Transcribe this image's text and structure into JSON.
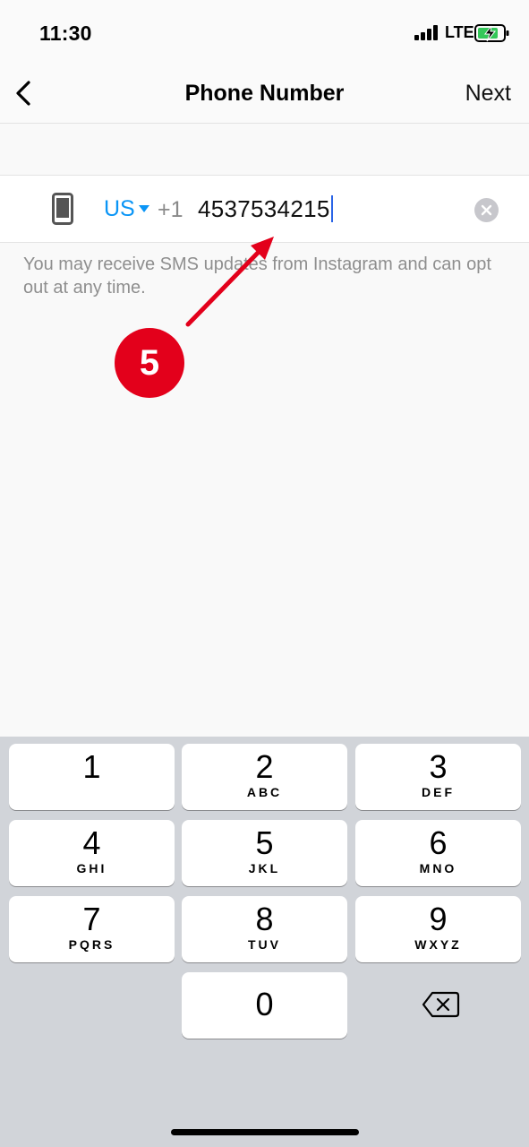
{
  "status_bar": {
    "time": "11:30",
    "network": "LTE",
    "icons": [
      "signal-bars-icon",
      "battery-charging-icon"
    ]
  },
  "nav": {
    "back_icon": "chevron-left-icon",
    "title": "Phone Number",
    "next_label": "Next"
  },
  "phone_input": {
    "device_icon": "smartphone-icon",
    "country": "US",
    "country_dropdown_icon": "caret-down-icon",
    "dial_code": "+1",
    "value": "4537534215",
    "clear_icon": "clear-x-icon"
  },
  "helper_text": "You may receive SMS updates from Instagram and can opt out at any time.",
  "annotation": {
    "step_number": "5",
    "color": "#e3001b"
  },
  "keypad": {
    "keys": [
      {
        "number": "1",
        "letters": ""
      },
      {
        "number": "2",
        "letters": "ABC"
      },
      {
        "number": "3",
        "letters": "DEF"
      },
      {
        "number": "4",
        "letters": "GHI"
      },
      {
        "number": "5",
        "letters": "JKL"
      },
      {
        "number": "6",
        "letters": "MNO"
      },
      {
        "number": "7",
        "letters": "PQRS"
      },
      {
        "number": "8",
        "letters": "TUV"
      },
      {
        "number": "9",
        "letters": "WXYZ"
      },
      {
        "number": "0",
        "letters": ""
      }
    ],
    "backspace_icon": "backspace-icon"
  },
  "colors": {
    "accent": "#0a95f6",
    "cursor": "#2a64e6",
    "annotation_red": "#e3001b"
  }
}
